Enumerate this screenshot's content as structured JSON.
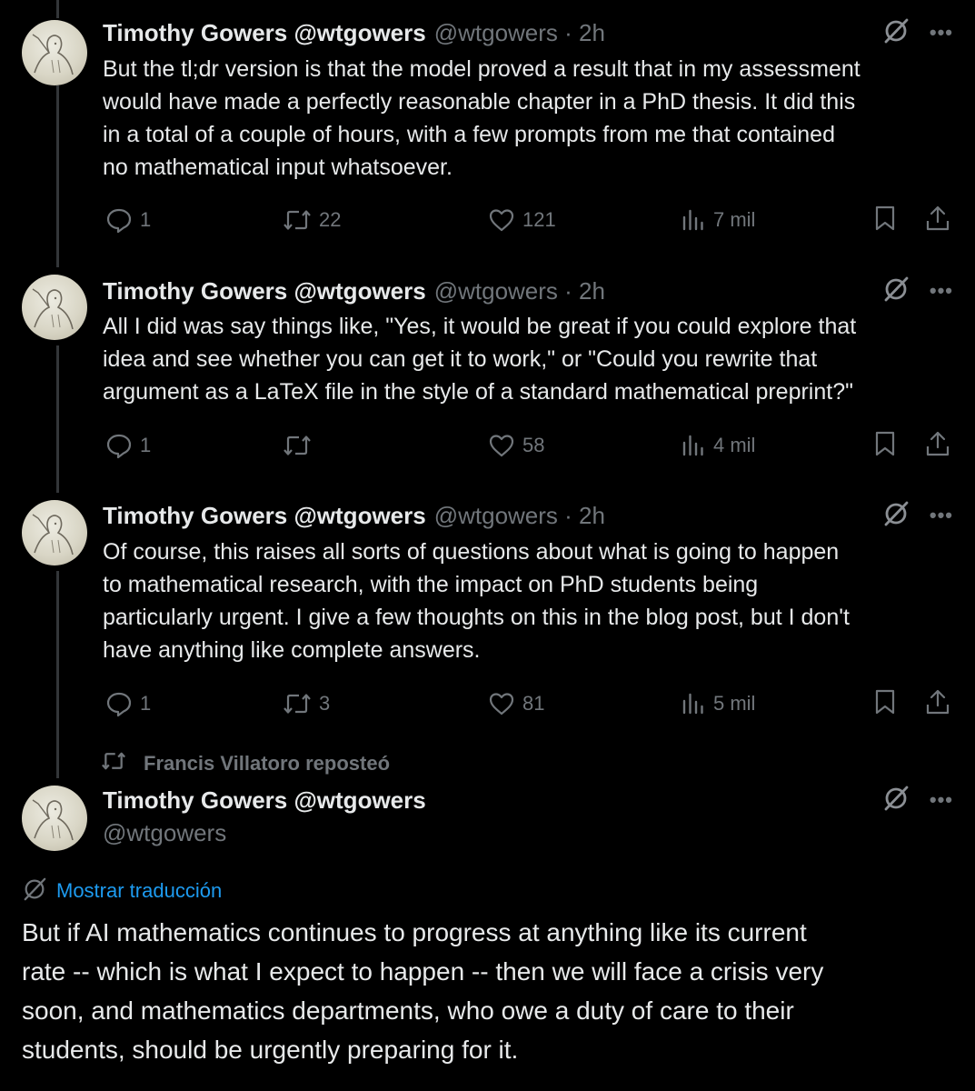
{
  "tweets": [
    {
      "author_name": "Timothy Gowers @wtgowers",
      "author_handle": "@wtgowers · 2h",
      "lines": [
        "But the tl;dr version is that the model proved a result that in my assessment",
        "would have made a perfectly reasonable chapter in a PhD thesis. It did this",
        "in a total of a couple of hours, with a few prompts from me that contained",
        "no mathematical input whatsoever."
      ],
      "replies": "1",
      "reposts": "22",
      "likes": "121",
      "views": "7 mil"
    },
    {
      "author_name": "Timothy Gowers @wtgowers",
      "author_handle": "@wtgowers · 2h",
      "lines": [
        "All I did was say things like, \"Yes, it would be great if you could explore that",
        "idea and see whether you can get it to work,\" or \"Could you rewrite that",
        "argument as a LaTeX file in the style of a standard mathematical preprint?\""
      ],
      "replies": "1",
      "reposts": "",
      "likes": "58",
      "views": "4 mil"
    },
    {
      "author_name": "Timothy Gowers @wtgowers",
      "author_handle": "@wtgowers · 2h",
      "lines": [
        "Of course, this raises all sorts of questions about what is going to happen",
        "to mathematical research, with the impact on PhD students being",
        "particularly urgent. I give a few thoughts on this in the blog post, but I don't",
        "have anything like complete answers."
      ],
      "replies": "1",
      "reposts": "3",
      "likes": "81",
      "views": "5 mil"
    }
  ],
  "repost_notice": "Francis Villatoro reposteó",
  "main_tweet": {
    "author_name": "Timothy Gowers @wtgowers",
    "author_handle": "@wtgowers",
    "translate_label": "Mostrar traducción",
    "lines": [
      "But if AI mathematics continues to progress at anything like its current",
      "rate -- which is what I expect to happen -- then we will face a crisis very",
      "soon, and mathematics departments, who owe a duty of care to their",
      "students, should be urgently preparing for it."
    ]
  },
  "icons": {
    "reply": "reply-icon",
    "repost": "repost-icon",
    "like": "heart-icon",
    "views": "views-icon",
    "bookmark": "bookmark-icon",
    "share": "share-icon",
    "grok": "grok-icon",
    "more": "more-icon",
    "translate": "translate-icon"
  },
  "colors": {
    "background": "#000000",
    "text": "#e7e9ea",
    "muted": "#71767b",
    "link": "#1d9bf0"
  }
}
